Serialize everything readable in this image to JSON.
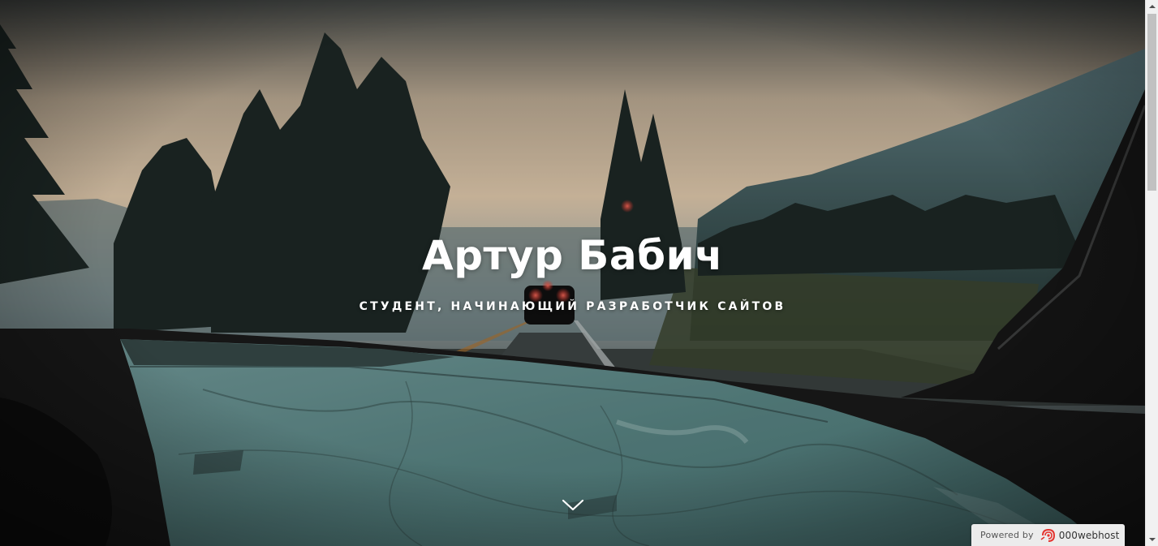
{
  "hero": {
    "title": "Артур Бабич",
    "subtitle": "студент, начинающий разработчик сайтов",
    "scroll_icon": "chevron-down-icon"
  },
  "badge": {
    "prefix": "Powered by",
    "brand": "000webhost",
    "logo_icon": "000webhost-logo-icon"
  },
  "scrollbar": {
    "up_icon": "triangle-up-icon",
    "down_icon": "triangle-down-icon"
  },
  "colors": {
    "sky_top": "#3a3f3d",
    "sky_glow": "#e9d2b2",
    "map_teal": "#6f9d9b",
    "dashboard": "#1e1d1d",
    "badge_bg": "#ececec",
    "accent_red": "#e4342f"
  }
}
